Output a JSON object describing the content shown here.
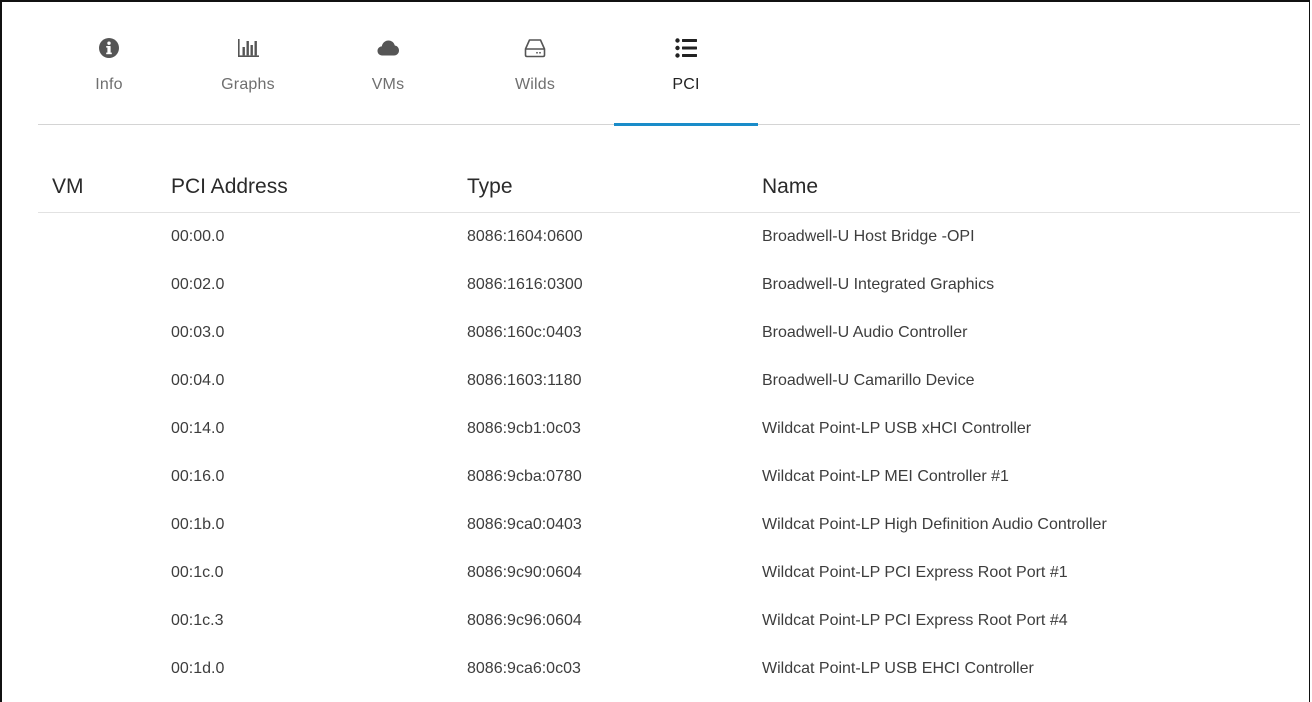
{
  "tabs": [
    {
      "id": "info",
      "label": "Info",
      "icon": "info-circle-icon",
      "active": false
    },
    {
      "id": "graphs",
      "label": "Graphs",
      "icon": "bar-chart-icon",
      "active": false
    },
    {
      "id": "vms",
      "label": "VMs",
      "icon": "cloud-icon",
      "active": false
    },
    {
      "id": "wilds",
      "label": "Wilds",
      "icon": "hard-drive-icon",
      "active": false
    },
    {
      "id": "pci",
      "label": "PCI",
      "icon": "list-icon",
      "active": true
    }
  ],
  "colors": {
    "accent": "#1a8cc9",
    "icon": "#555555"
  },
  "table": {
    "columns": [
      "VM",
      "PCI Address",
      "Type",
      "Name"
    ],
    "rows": [
      {
        "vm": "",
        "address": "00:00.0",
        "type": "8086:1604:0600",
        "name": "Broadwell-U Host Bridge -OPI"
      },
      {
        "vm": "",
        "address": "00:02.0",
        "type": "8086:1616:0300",
        "name": "Broadwell-U Integrated Graphics"
      },
      {
        "vm": "",
        "address": "00:03.0",
        "type": "8086:160c:0403",
        "name": "Broadwell-U Audio Controller"
      },
      {
        "vm": "",
        "address": "00:04.0",
        "type": "8086:1603:1180",
        "name": "Broadwell-U Camarillo Device"
      },
      {
        "vm": "",
        "address": "00:14.0",
        "type": "8086:9cb1:0c03",
        "name": "Wildcat Point-LP USB xHCI Controller"
      },
      {
        "vm": "",
        "address": "00:16.0",
        "type": "8086:9cba:0780",
        "name": "Wildcat Point-LP MEI Controller #1"
      },
      {
        "vm": "",
        "address": "00:1b.0",
        "type": "8086:9ca0:0403",
        "name": "Wildcat Point-LP High Definition Audio Controller"
      },
      {
        "vm": "",
        "address": "00:1c.0",
        "type": "8086:9c90:0604",
        "name": "Wildcat Point-LP PCI Express Root Port #1"
      },
      {
        "vm": "",
        "address": "00:1c.3",
        "type": "8086:9c96:0604",
        "name": "Wildcat Point-LP PCI Express Root Port #4"
      },
      {
        "vm": "",
        "address": "00:1d.0",
        "type": "8086:9ca6:0c03",
        "name": "Wildcat Point-LP USB EHCI Controller"
      }
    ]
  }
}
